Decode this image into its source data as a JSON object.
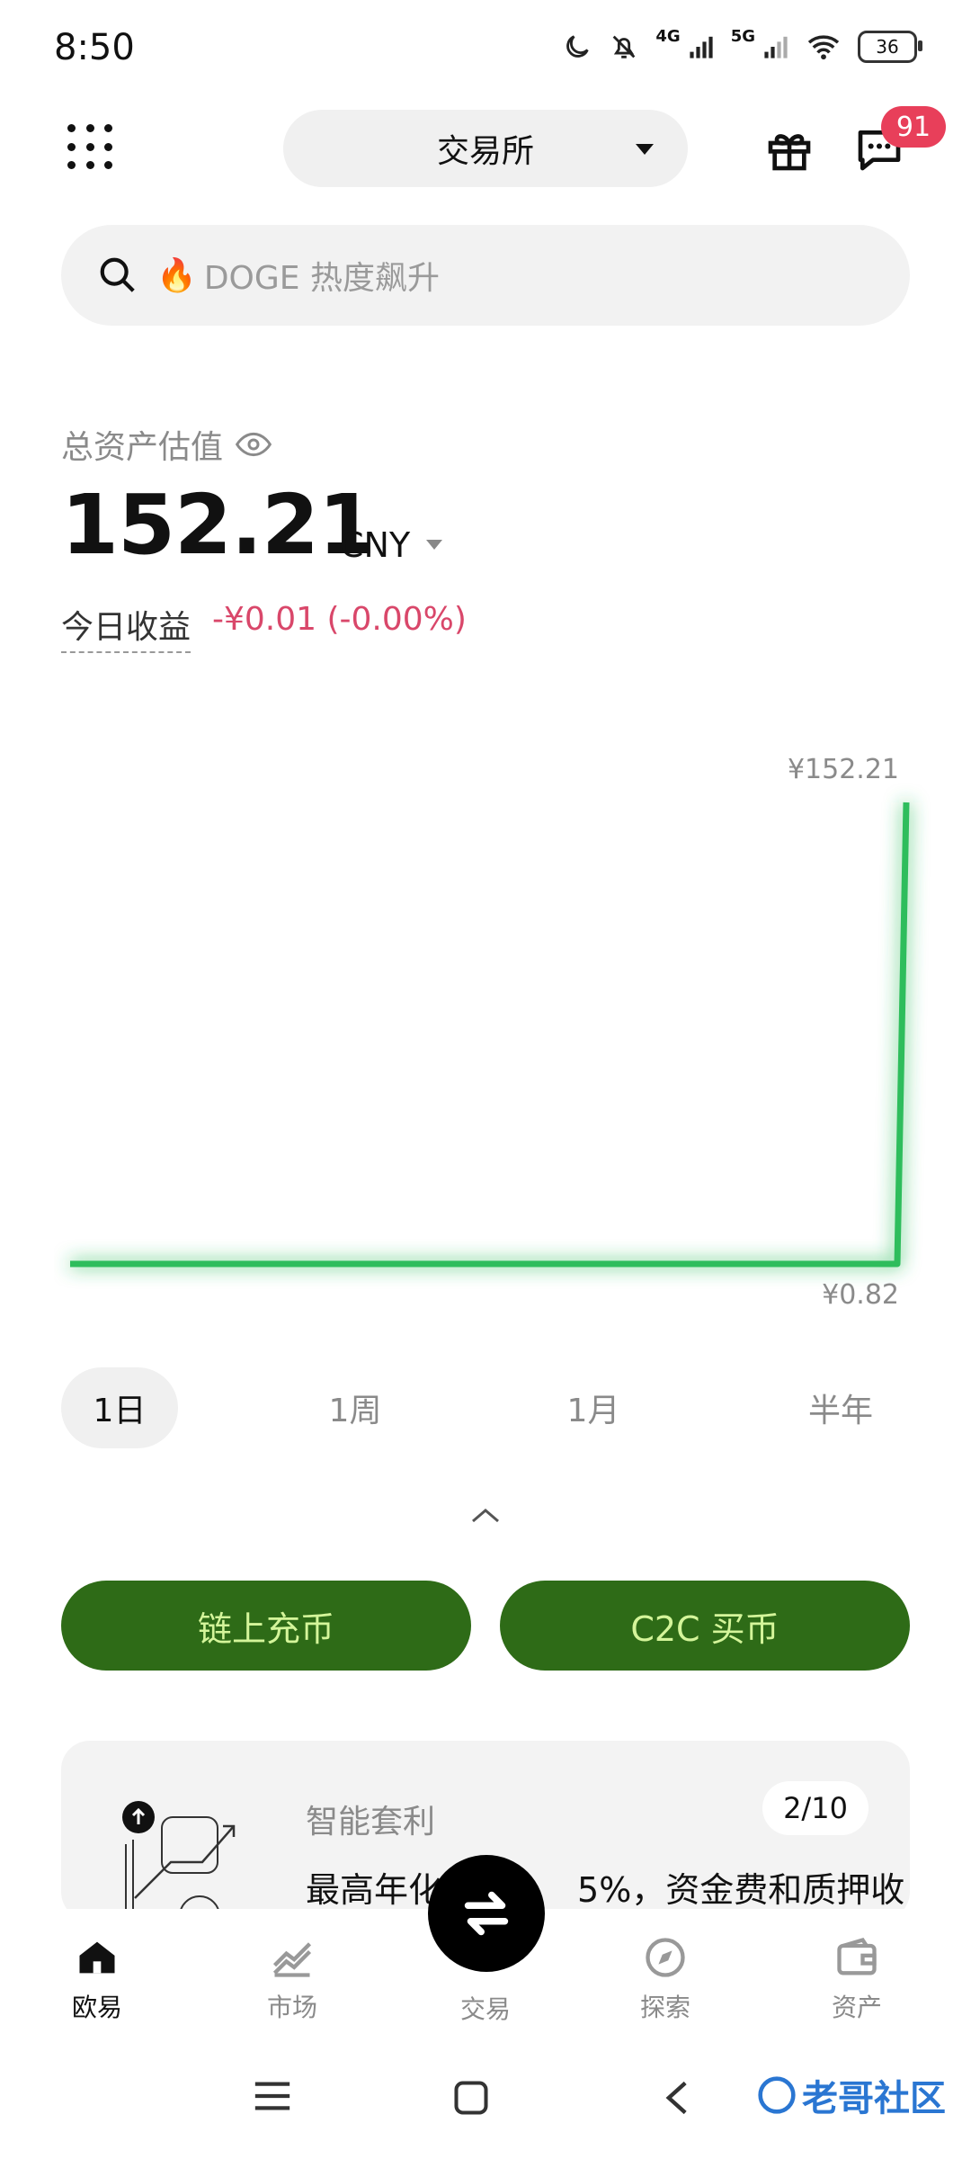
{
  "status_bar": {
    "time": "8:50",
    "net1": "4G",
    "net2": "5G",
    "battery": "36"
  },
  "topbar": {
    "exchange_label": "交易所",
    "badge_count": "91"
  },
  "search": {
    "placeholder": "DOGE 热度飙升"
  },
  "assets": {
    "label": "总资产估值",
    "value": "152.21",
    "unit": "CNY",
    "pnl_label": "今日收益",
    "pnl_value": "-¥0.01 (-0.00%)"
  },
  "chart_data": {
    "type": "line",
    "title": "",
    "xlabel": "",
    "ylabel": "",
    "max_label": "¥152.21",
    "min_label": "¥0.82",
    "series": [
      {
        "values": [
          0.82,
          0.82,
          0.82,
          0.82,
          0.82,
          0.82,
          0.82,
          0.82,
          0.82,
          0.82,
          0.82,
          0.82,
          152.21
        ]
      }
    ],
    "ylim": [
      0.82,
      152.21
    ],
    "grid": false,
    "color": "#2ebd5b"
  },
  "range_tabs": [
    "1日",
    "1周",
    "1月",
    "半年"
  ],
  "actions": {
    "deposit": "链上充币",
    "c2c": "C2C 买币"
  },
  "card": {
    "title": "智能套利",
    "page": "2/10",
    "desc_left": "最高年化",
    "desc_right": "5%，资金费和质押收"
  },
  "bottom_nav": {
    "home": "欧易",
    "market": "市场",
    "trade": "交易",
    "explore": "探索",
    "assets": "资产"
  },
  "watermark": "老哥社区",
  "colors": {
    "accent_green": "#2e6b17",
    "button_text": "#d4f59a",
    "negative": "#d9476a",
    "badge": "#e83f5a"
  }
}
